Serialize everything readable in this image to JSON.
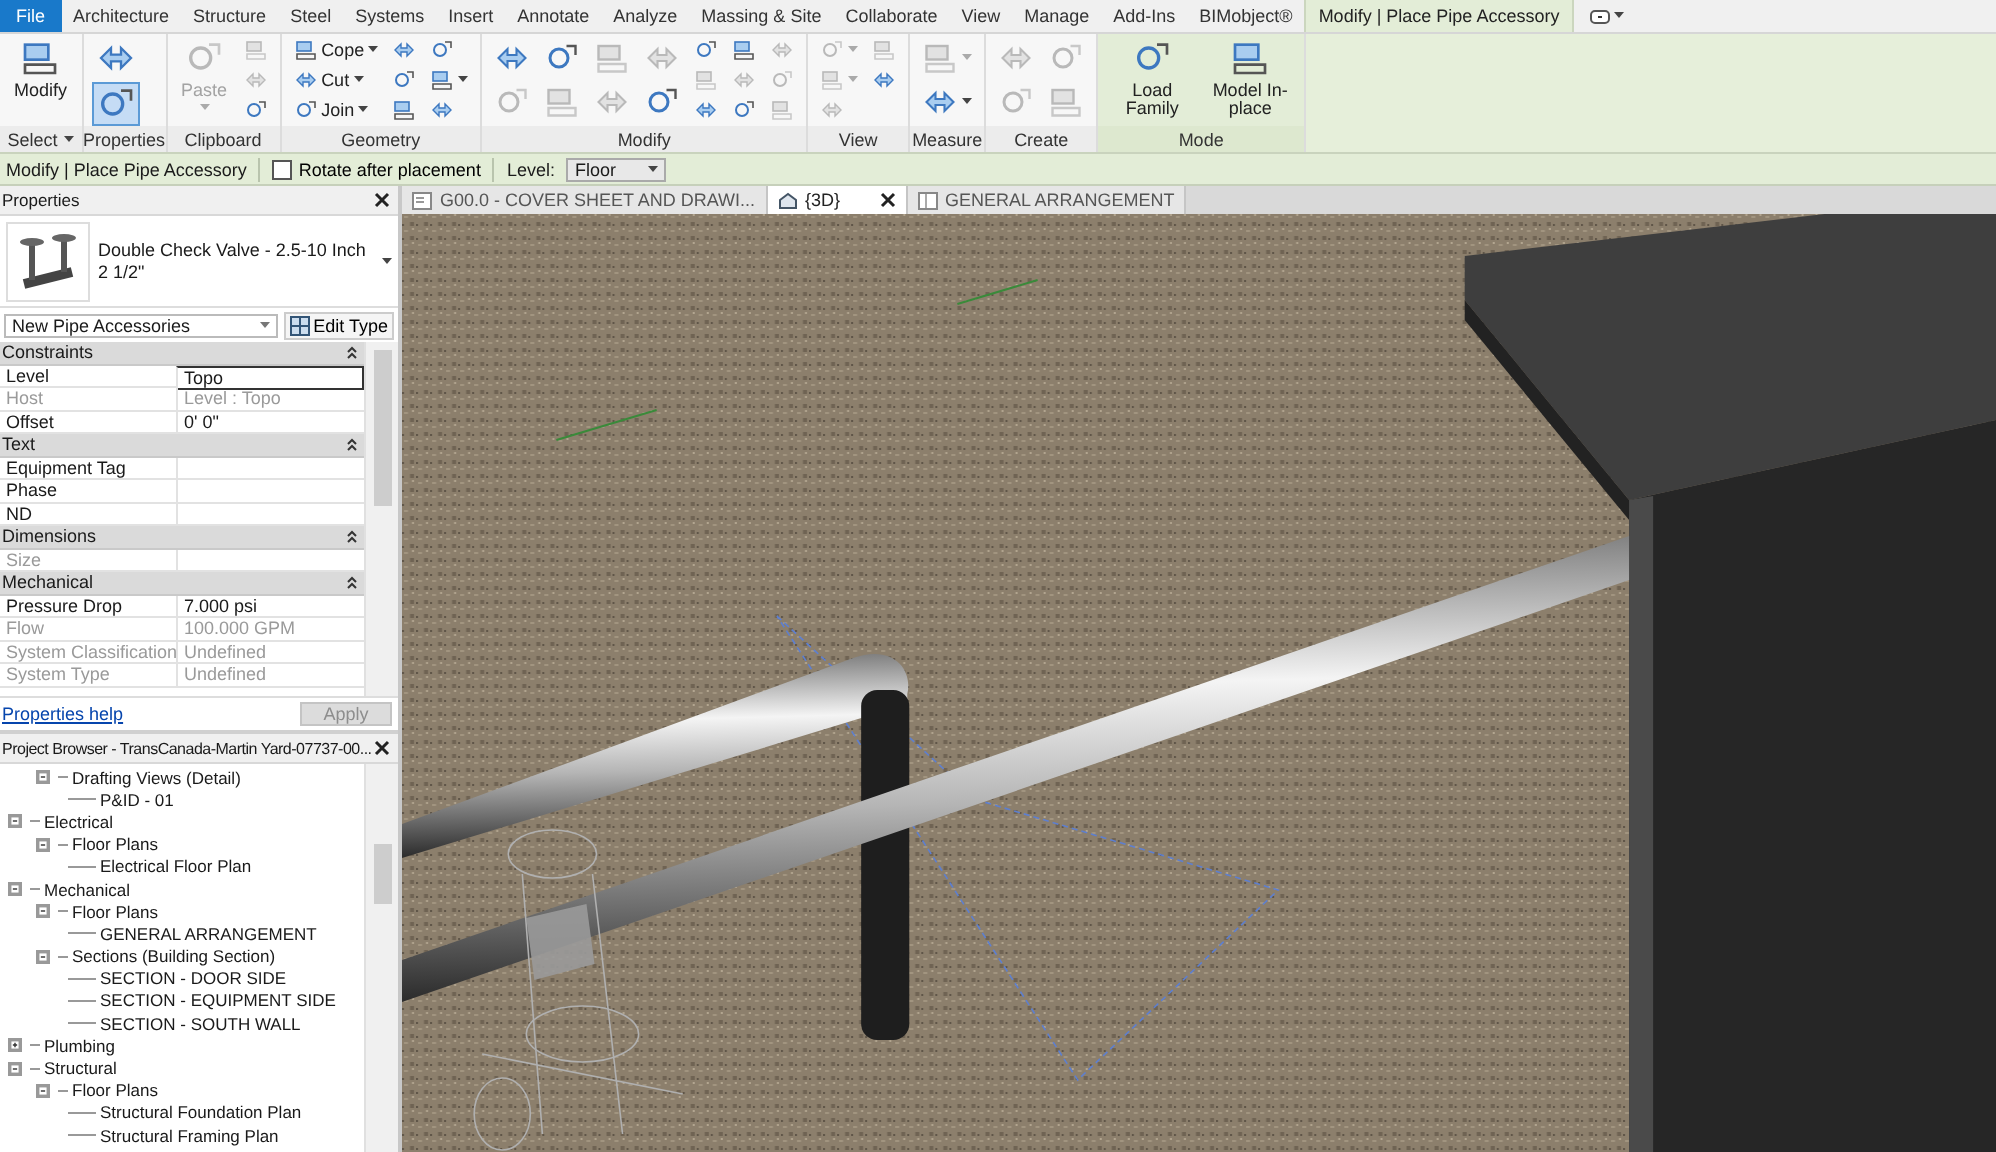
{
  "menu_tabs": [
    {
      "label": "File",
      "kind": "file",
      "selected": false
    },
    {
      "label": "Architecture",
      "kind": "tab",
      "selected": false
    },
    {
      "label": "Structure",
      "kind": "tab",
      "selected": false
    },
    {
      "label": "Steel",
      "kind": "tab",
      "selected": false
    },
    {
      "label": "Systems",
      "kind": "tab",
      "selected": false
    },
    {
      "label": "Insert",
      "kind": "tab",
      "selected": false
    },
    {
      "label": "Annotate",
      "kind": "tab",
      "selected": false
    },
    {
      "label": "Analyze",
      "kind": "tab",
      "selected": false
    },
    {
      "label": "Massing & Site",
      "kind": "tab",
      "selected": false
    },
    {
      "label": "Collaborate",
      "kind": "tab",
      "selected": false
    },
    {
      "label": "View",
      "kind": "tab",
      "selected": false
    },
    {
      "label": "Manage",
      "kind": "tab",
      "selected": false
    },
    {
      "label": "Add-Ins",
      "kind": "tab",
      "selected": false
    },
    {
      "label": "BIMobject®",
      "kind": "tab",
      "selected": false
    },
    {
      "label": "Modify | Place Pipe Accessory",
      "kind": "context",
      "selected": true
    }
  ],
  "ribbon": {
    "panels": [
      {
        "title": "Select",
        "title_dropdown": true,
        "contextual": false,
        "columns": [
          [
            {
              "kind": "large",
              "label": "Modify",
              "disabled": false,
              "selected": false,
              "dropdown": false
            }
          ]
        ]
      },
      {
        "title": "Properties",
        "title_dropdown": false,
        "contextual": false,
        "columns": [
          [
            {
              "kind": "big",
              "disabled": false,
              "selected": false,
              "dropdown": false
            },
            {
              "kind": "big",
              "disabled": false,
              "selected": true,
              "dropdown": false
            }
          ]
        ]
      },
      {
        "title": "Clipboard",
        "title_dropdown": false,
        "contextual": false,
        "columns": [
          [
            {
              "kind": "large",
              "label": "Paste",
              "disabled": true,
              "selected": false,
              "dropdown": true
            }
          ],
          [
            {
              "kind": "small",
              "disabled": true,
              "selected": false,
              "dropdown": false
            },
            {
              "kind": "small",
              "disabled": true,
              "selected": false,
              "dropdown": false
            },
            {
              "kind": "small",
              "disabled": false,
              "selected": false,
              "dropdown": false
            }
          ]
        ]
      },
      {
        "title": "Geometry",
        "title_dropdown": false,
        "contextual": false,
        "columns": [
          [
            {
              "kind": "small",
              "label": "Cope",
              "disabled": false,
              "selected": false,
              "dropdown": true
            },
            {
              "kind": "small",
              "label": "Cut",
              "disabled": false,
              "selected": false,
              "dropdown": true
            },
            {
              "kind": "small",
              "label": "Join",
              "disabled": false,
              "selected": false,
              "dropdown": true
            }
          ],
          [
            {
              "kind": "small",
              "disabled": false,
              "selected": false,
              "dropdown": false
            },
            {
              "kind": "small",
              "disabled": false,
              "selected": false,
              "dropdown": false
            },
            {
              "kind": "small",
              "disabled": false,
              "selected": false,
              "dropdown": false
            }
          ],
          [
            {
              "kind": "small",
              "disabled": false,
              "selected": false,
              "dropdown": false
            },
            {
              "kind": "small",
              "disabled": false,
              "selected": false,
              "dropdown": true
            },
            {
              "kind": "small",
              "disabled": false,
              "selected": false,
              "dropdown": false
            }
          ]
        ]
      },
      {
        "title": "Modify",
        "title_dropdown": false,
        "contextual": false,
        "columns": [
          [
            {
              "kind": "medium",
              "disabled": false,
              "selected": false,
              "dropdown": false
            },
            {
              "kind": "medium",
              "disabled": true,
              "selected": false,
              "dropdown": false
            }
          ],
          [
            {
              "kind": "medium",
              "disabled": false,
              "selected": false,
              "dropdown": false
            },
            {
              "kind": "medium",
              "disabled": true,
              "selected": false,
              "dropdown": false
            }
          ],
          [
            {
              "kind": "medium",
              "disabled": true,
              "selected": false,
              "dropdown": false
            },
            {
              "kind": "medium",
              "disabled": true,
              "selected": false,
              "dropdown": false
            }
          ],
          [
            {
              "kind": "medium",
              "disabled": true,
              "selected": false,
              "dropdown": false
            },
            {
              "kind": "medium",
              "disabled": false,
              "selected": false,
              "dropdown": false
            }
          ],
          [
            {
              "kind": "small",
              "disabled": false,
              "selected": false,
              "dropdown": false
            },
            {
              "kind": "small",
              "disabled": true,
              "selected": false,
              "dropdown": false
            },
            {
              "kind": "small",
              "disabled": false,
              "selected": false,
              "dropdown": false
            }
          ],
          [
            {
              "kind": "small",
              "disabled": false,
              "selected": false,
              "dropdown": false
            },
            {
              "kind": "small",
              "disabled": true,
              "selected": false,
              "dropdown": false
            },
            {
              "kind": "small",
              "disabled": false,
              "selected": false,
              "dropdown": false
            }
          ],
          [
            {
              "kind": "small",
              "disabled": true,
              "selected": false,
              "dropdown": false
            },
            {
              "kind": "small",
              "disabled": true,
              "selected": false,
              "dropdown": false
            },
            {
              "kind": "small",
              "disabled": true,
              "selected": false,
              "dropdown": false
            }
          ]
        ]
      },
      {
        "title": "View",
        "title_dropdown": false,
        "contextual": false,
        "columns": [
          [
            {
              "kind": "small",
              "disabled": true,
              "selected": false,
              "dropdown": true
            },
            {
              "kind": "small",
              "disabled": true,
              "selected": false,
              "dropdown": true
            },
            {
              "kind": "small",
              "disabled": true,
              "selected": false,
              "dropdown": false
            }
          ],
          [
            {
              "kind": "small",
              "disabled": true,
              "selected": false,
              "dropdown": false
            },
            {
              "kind": "small",
              "disabled": false,
              "selected": false,
              "dropdown": false
            }
          ]
        ]
      },
      {
        "title": "Measure",
        "title_dropdown": false,
        "contextual": false,
        "columns": [
          [
            {
              "kind": "medium",
              "disabled": true,
              "selected": false,
              "dropdown": true
            },
            {
              "kind": "medium",
              "disabled": false,
              "selected": false,
              "dropdown": true
            }
          ]
        ]
      },
      {
        "title": "Create",
        "title_dropdown": false,
        "contextual": false,
        "columns": [
          [
            {
              "kind": "medium",
              "disabled": true,
              "selected": false,
              "dropdown": false
            },
            {
              "kind": "medium",
              "disabled": true,
              "selected": false,
              "dropdown": false
            }
          ],
          [
            {
              "kind": "medium",
              "disabled": true,
              "selected": false,
              "dropdown": false
            },
            {
              "kind": "medium",
              "disabled": true,
              "selected": false,
              "dropdown": false
            }
          ]
        ]
      },
      {
        "title": "Mode",
        "title_dropdown": false,
        "contextual": true,
        "columns": [
          [
            {
              "kind": "large",
              "label": "Load Family",
              "disabled": false,
              "selected": false,
              "dropdown": false
            }
          ],
          [
            {
              "kind": "large",
              "label": "Model In-place",
              "disabled": false,
              "selected": false,
              "dropdown": false
            }
          ]
        ]
      }
    ]
  },
  "options_bar": {
    "mode": "Modify | Place Pipe Accessory",
    "rotate_checkbox": {
      "label": "Rotate after placement",
      "checked": false
    },
    "level_label": "Level:",
    "level_value": "Floor"
  },
  "properties": {
    "title": "Properties",
    "type_name": "Double Check Valve - 2.5-10 Inch",
    "type_size": "2 1/2\"",
    "category": "New Pipe Accessories",
    "edit_type": "Edit Type",
    "groups": [
      {
        "name": "Constraints",
        "expanded": true,
        "rows": [
          {
            "label": "Level",
            "value": "Topo",
            "disabled": false,
            "editing": true
          },
          {
            "label": "Host",
            "value": "Level : Topo",
            "disabled": true,
            "editing": false
          },
          {
            "label": "Offset",
            "value": "0'  0\"",
            "disabled": false,
            "editing": false
          }
        ]
      },
      {
        "name": "Text",
        "expanded": true,
        "rows": [
          {
            "label": "Equipment Tag",
            "disabled": false,
            "editing": false
          },
          {
            "label": "Phase",
            "disabled": false,
            "editing": false
          },
          {
            "label": "ND",
            "disabled": false,
            "editing": false
          }
        ]
      },
      {
        "name": "Dimensions",
        "expanded": true,
        "rows": [
          {
            "label": "Size",
            "disabled": true,
            "editing": false
          }
        ]
      },
      {
        "name": "Mechanical",
        "expanded": true,
        "rows": [
          {
            "label": "Pressure Drop",
            "value": "7.000 psi",
            "disabled": false,
            "editing": false
          },
          {
            "label": "Flow",
            "value": "100.000 GPM",
            "disabled": true,
            "editing": false
          },
          {
            "label": "System Classification",
            "value": "Undefined",
            "disabled": true,
            "editing": false
          },
          {
            "label": "System Type",
            "value": "Undefined",
            "disabled": true,
            "editing": false
          }
        ]
      }
    ],
    "help_link": "Properties help",
    "apply": {
      "label": "Apply",
      "disabled": true
    }
  },
  "project_browser": {
    "title": "Project Browser - TransCanada-Martin Yard-07737-00...",
    "continued": [
      {
        "label": "Drafting Views (Detail)",
        "expanded": true,
        "children": [
          {
            "label": "P&ID - 01"
          }
        ]
      }
    ],
    "items": [
      {
        "label": "Electrical",
        "expanded": true,
        "children": [
          {
            "label": "Floor Plans",
            "expanded": true,
            "children": [
              {
                "label": "Electrical Floor Plan"
              }
            ]
          }
        ]
      },
      {
        "label": "Mechanical",
        "expanded": true,
        "children": [
          {
            "label": "Floor Plans",
            "expanded": true,
            "children": [
              {
                "label": "GENERAL ARRANGEMENT"
              }
            ]
          },
          {
            "label": "Sections (Building Section)",
            "expanded": true,
            "children": [
              {
                "label": "SECTION - DOOR SIDE"
              },
              {
                "label": "SECTION - EQUIPMENT SIDE"
              },
              {
                "label": "SECTION - SOUTH WALL"
              }
            ]
          }
        ]
      },
      {
        "label": "Plumbing",
        "expanded": false
      },
      {
        "label": "Structural",
        "expanded": true,
        "children": [
          {
            "label": "Floor Plans",
            "expanded": true,
            "children": [
              {
                "label": "Structural Foundation Plan"
              },
              {
                "label": "Structural Framing Plan"
              }
            ]
          }
        ]
      }
    ]
  },
  "view_tabs": [
    {
      "label": "G00.0 - COVER SHEET AND DRAWI...",
      "kind": "sheet",
      "selected": false
    },
    {
      "label": "{3D}",
      "kind": "model",
      "selected": true
    },
    {
      "label": "GENERAL ARRANGEMENT",
      "kind": "plan",
      "selected": false
    }
  ]
}
